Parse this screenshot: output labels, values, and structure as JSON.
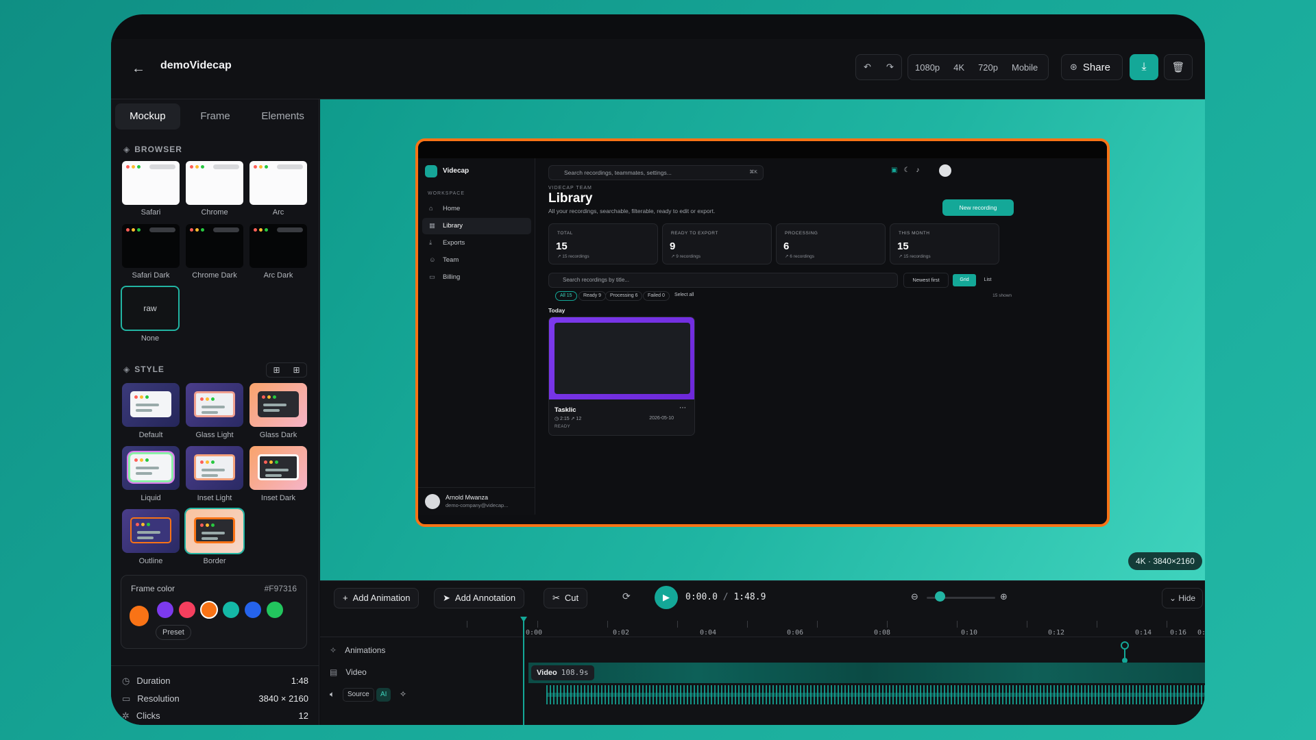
{
  "header": {
    "title": "demoVidecap",
    "res_options": [
      "1080p",
      "4K",
      "720p",
      "Mobile"
    ],
    "share_label": "Share"
  },
  "sidebar": {
    "tabs": [
      "Mockup",
      "Frame",
      "Elements"
    ],
    "browser_heading": "BROWSER",
    "browsers": [
      "Safari",
      "Chrome",
      "Arc",
      "Safari Dark",
      "Chrome Dark",
      "Arc Dark"
    ],
    "none_thumb": "raw",
    "none_label": "None",
    "style_heading": "STYLE",
    "styles": [
      "Default",
      "Glass Light",
      "Glass Dark",
      "Liquid",
      "Inset Light",
      "Inset Dark",
      "Outline",
      "Border"
    ],
    "frame_color_label": "Frame color",
    "frame_color_value": "#F97316",
    "swatches": [
      "#f97316",
      "#7c3aed",
      "#f43f5e",
      "#f97316",
      "#14b8a6",
      "#2563eb",
      "#22c55e"
    ],
    "preset_label": "Preset",
    "stats": [
      {
        "label": "Duration",
        "value": "1:48"
      },
      {
        "label": "Resolution",
        "value": "3840 × 2160"
      },
      {
        "label": "Clicks",
        "value": "12"
      }
    ]
  },
  "mockup": {
    "app_name": "Videcap",
    "workspace_label": "WORKSPACE",
    "nav": [
      "Home",
      "Library",
      "Exports",
      "Team",
      "Billing"
    ],
    "search_placeholder": "Search recordings, teammates, settings...",
    "search_kbd": "⌘K",
    "team_tag": "VIDECAP TEAM",
    "page_title": "Library",
    "page_sub": "All your recordings, searchable, filterable, ready to edit or export.",
    "new_recording": "New recording",
    "cards": [
      {
        "label": "TOTAL",
        "value": "15",
        "sub": "↗ 15 recordings"
      },
      {
        "label": "READY TO EXPORT",
        "value": "9",
        "sub": "↗ 9 recordings"
      },
      {
        "label": "PROCESSING",
        "value": "6",
        "sub": "↗ 6 recordings"
      },
      {
        "label": "THIS MONTH",
        "value": "15",
        "sub": "↗ 15 recordings"
      }
    ],
    "title_search": "Search recordings by title...",
    "sort": "Newest first",
    "grid": "Grid",
    "list": "List",
    "filters": [
      "All 15",
      "Ready 9",
      "Processing 6",
      "Failed 0",
      "Select all"
    ],
    "shown": "15 shown",
    "today": "Today",
    "recording": {
      "name": "Tasklic",
      "meta": "◷ 2:15   ↗ 12",
      "date": "2026-05-10",
      "status": "READY"
    },
    "user": {
      "name": "Arnold Mwanza",
      "email": "demo-company@videcap..."
    }
  },
  "canvas": {
    "badge": "4K · 3840×2160"
  },
  "timeline": {
    "add_animation": "Add Animation",
    "add_annotation": "Add Annotation",
    "cut": "Cut",
    "current": "0:00.0",
    "sep": " / ",
    "total": "1:48.9",
    "hide": "Hide",
    "ticks": [
      "0:00",
      "0:02",
      "0:04",
      "0:06",
      "0:08",
      "0:10",
      "0:12",
      "0:14",
      "0:16",
      "0:"
    ],
    "tracks": [
      "Animations",
      "Video"
    ],
    "video_chip": "Video",
    "video_len": "108.9s",
    "source": "Source",
    "ai": "AI"
  },
  "colors": {
    "accent": "#14a898",
    "frame": "#F97316"
  }
}
